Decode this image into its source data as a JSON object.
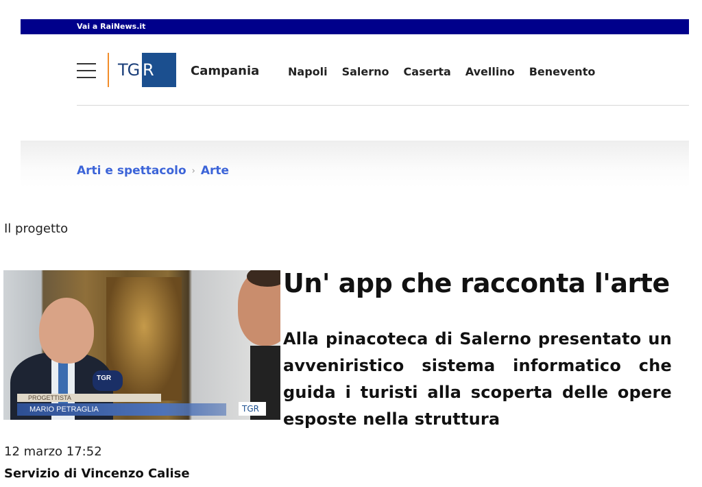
{
  "topbar": {
    "link_label": "Vai a RaiNews.it"
  },
  "header": {
    "logo_left": "TG",
    "logo_right": "R",
    "region": "Campania",
    "nav": [
      "Napoli",
      "Salerno",
      "Caserta",
      "Avellino",
      "Benevento"
    ],
    "brand_color": "#00008b",
    "accent_color": "#f28c28"
  },
  "breadcrumb": {
    "items": [
      "Arti e spettacolo",
      "Arte"
    ],
    "separator": "›",
    "link_color": "#3c64d8"
  },
  "article": {
    "kicker": "Il progetto",
    "title": "Un' app che racconta l'arte",
    "subtitle": "Alla pinacoteca di Salerno presentato un avveniristico sistema informatico che guida i turisti alla scoperta delle opere esposte nella struttura",
    "date": "12 marzo 17:52",
    "byline": "Servizio di Vincenzo Calise",
    "video": {
      "lower_third_role": "PROGETTISTA",
      "lower_third_name": "MARIO PETRAGLIA",
      "bug": "TGR",
      "mic_label": "TGR"
    }
  }
}
